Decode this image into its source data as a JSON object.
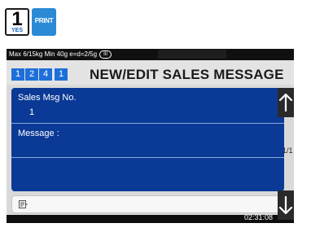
{
  "keys": {
    "num_label": "1",
    "yes_label": "YES",
    "print_label": "PRINT"
  },
  "status": {
    "text": "Max 6/15kg Min 40g e=d=2/5g",
    "badge": "III"
  },
  "header": {
    "breadcrumbs": [
      "1",
      "2",
      "4",
      "1"
    ],
    "title": "NEW/EDIT SALES MESSAGE"
  },
  "form": {
    "sales_msg_no_label": "Sales Msg No.",
    "sales_msg_no_value": "1",
    "message_label": "Message  :"
  },
  "pager": {
    "page": "1/1"
  },
  "clock": "02:31:08",
  "colors": {
    "panel": "#0b3a96",
    "crumb": "#1e6fd9",
    "print_key": "#2b8ad6"
  }
}
